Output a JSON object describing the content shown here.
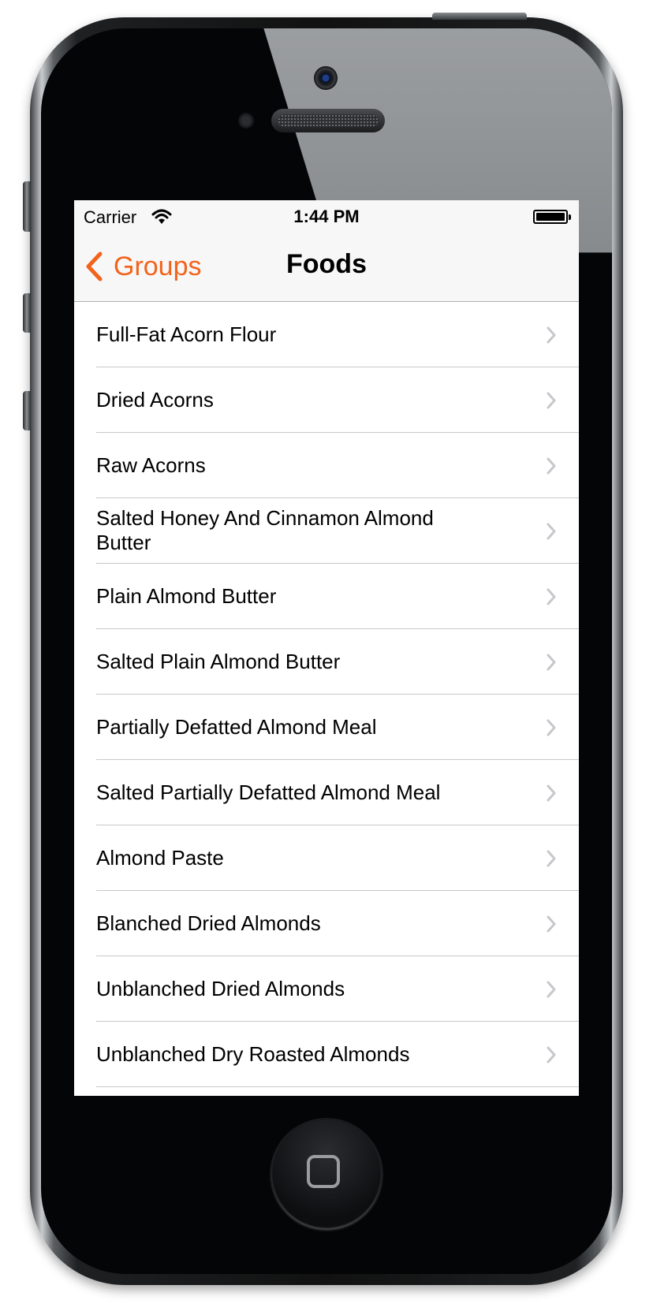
{
  "status_bar": {
    "carrier": "Carrier",
    "time": "1:44 PM",
    "wifi_icon": "wifi-icon",
    "battery_icon": "battery-icon"
  },
  "nav": {
    "back_label": "Groups",
    "title": "Foods",
    "accent_color": "#f2631c"
  },
  "foods": [
    "Full-Fat  Acorn Flour",
    "Dried Acorns",
    "Raw Acorns",
    "Salted  Honey And Cinnamon Almond Butter",
    "Plain Almond Butter",
    "Salted  Plain Almond Butter",
    "Partially Defatted Almond Meal",
    "Salted  Partially Defatted Almond Meal",
    "Almond Paste",
    "Blanched  Dried Almonds",
    "Unblanched  Dried Almonds",
    "Unblanched  Dry Roasted Almonds"
  ]
}
